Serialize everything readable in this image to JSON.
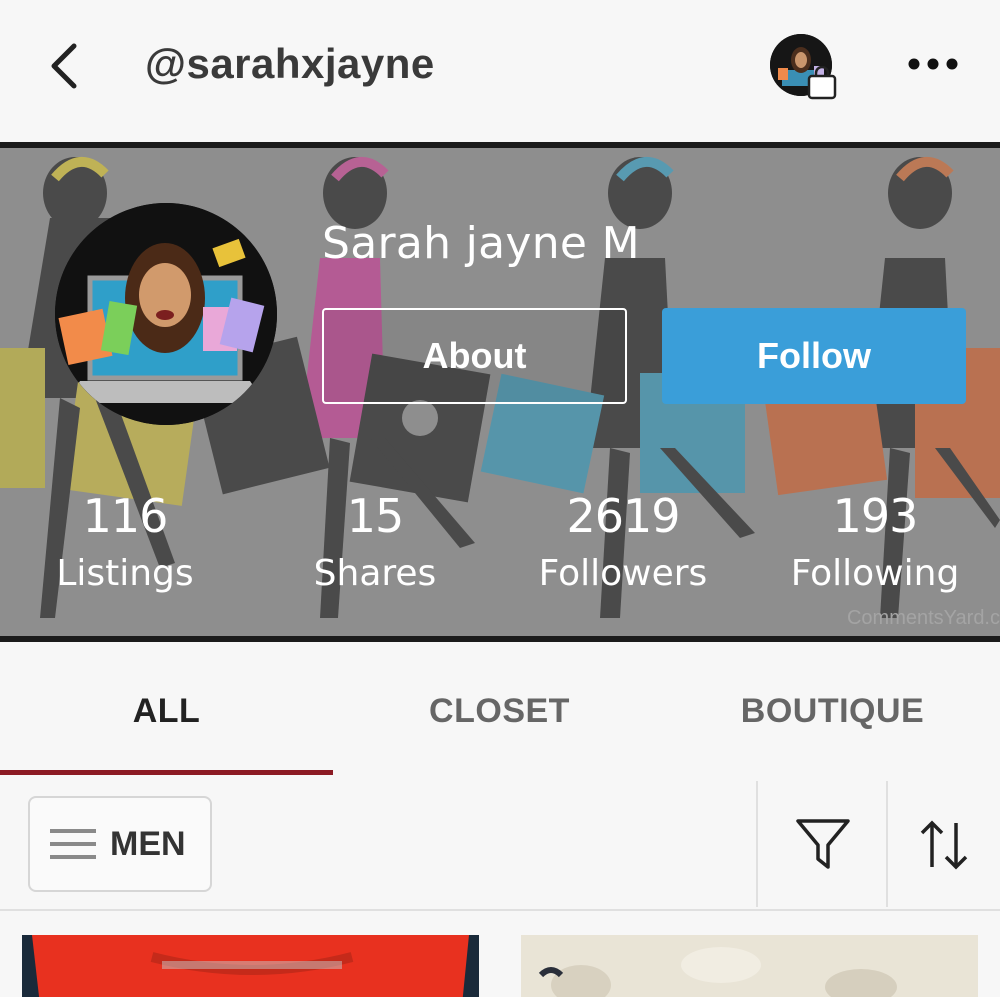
{
  "header": {
    "username": "@sarahxjayne",
    "back_icon": "chevron-left-icon",
    "more_icon": "more-horizontal-icon",
    "shop_icon": "shopping-bag-icon"
  },
  "profile": {
    "display_name": "Sarah jayne M",
    "about_label": "About",
    "follow_label": "Follow",
    "follow_color": "#3a9ed9",
    "watermark": "CommentsYard.c"
  },
  "stats": [
    {
      "value": "116",
      "label": "Listings"
    },
    {
      "value": "15",
      "label": "Shares"
    },
    {
      "value": "2619",
      "label": "Followers"
    },
    {
      "value": "193",
      "label": "Following"
    }
  ],
  "tabs": [
    {
      "label": "ALL",
      "active": true,
      "color": "#222222"
    },
    {
      "label": "CLOSET",
      "active": false,
      "color": "#666666"
    },
    {
      "label": "BOUTIQUE",
      "active": false,
      "color": "#666666"
    }
  ],
  "tab_indicator_color": "#8c1b24",
  "toolbar": {
    "department_label": "MEN",
    "menu_icon": "hamburger-menu-icon",
    "filter_icon": "filter-icon",
    "sort_icon": "sort-arrows-icon"
  },
  "listings": [
    {
      "kind": "red-shirt-photo",
      "color": "#e8311f"
    },
    {
      "kind": "fleece-photo",
      "color": "#e9e4d6"
    }
  ]
}
